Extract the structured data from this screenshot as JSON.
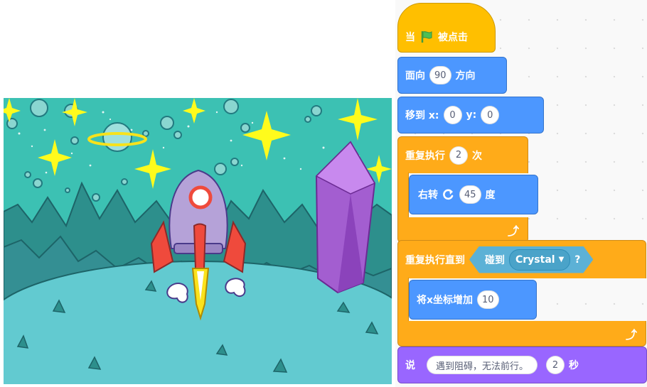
{
  "stage": {
    "scene": "space",
    "sprites": [
      "rocket",
      "crystal"
    ]
  },
  "script": {
    "hat": {
      "prefix": "当",
      "icon": "green-flag-icon",
      "suffix": "被点击"
    },
    "point_direction": {
      "prefix": "面向",
      "value": "90",
      "suffix": "方向"
    },
    "goto": {
      "prefix": "移到 x:",
      "x": "0",
      "y_label": "y:",
      "y": "0"
    },
    "repeat": {
      "prefix": "重复执行",
      "count": "2",
      "suffix": "次"
    },
    "turn_right": {
      "prefix": "右转",
      "icon": "rotate-right-icon",
      "degrees": "45",
      "suffix": "度"
    },
    "repeat_until": {
      "prefix": "重复执行直到",
      "touching_label": "碰到",
      "target": "Crystal",
      "question": "?"
    },
    "change_x": {
      "prefix": "将x坐标增加",
      "value": "10"
    },
    "say": {
      "prefix": "说",
      "message": "遇到阻碍，无法前行。",
      "seconds": "2",
      "suffix": "秒"
    }
  },
  "colors": {
    "events": "#ffbf00",
    "motion": "#4c97ff",
    "control": "#ffab19",
    "sensing": "#5cb1d6",
    "looks": "#9966ff"
  }
}
